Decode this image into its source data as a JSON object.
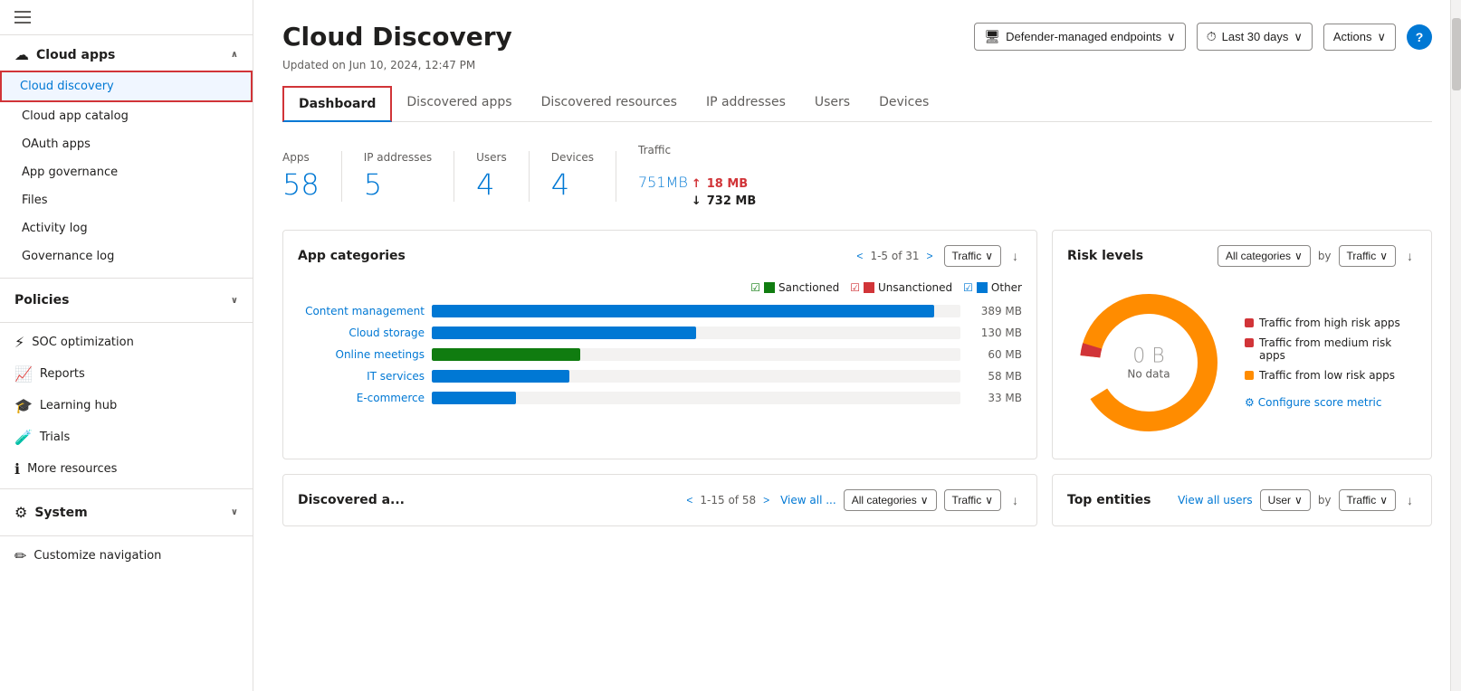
{
  "sidebar": {
    "hamburger_label": "Menu",
    "sections": [
      {
        "id": "cloud-apps",
        "label": "Cloud apps",
        "expanded": true,
        "items": [
          {
            "id": "cloud-discovery",
            "label": "Cloud discovery",
            "active": true
          },
          {
            "id": "cloud-app-catalog",
            "label": "Cloud app catalog"
          },
          {
            "id": "oauth-apps",
            "label": "OAuth apps"
          },
          {
            "id": "app-governance",
            "label": "App governance"
          },
          {
            "id": "files",
            "label": "Files"
          },
          {
            "id": "activity-log",
            "label": "Activity log"
          },
          {
            "id": "governance-log",
            "label": "Governance log"
          }
        ]
      },
      {
        "id": "policies",
        "label": "Policies",
        "expanded": false,
        "items": []
      }
    ],
    "main_items": [
      {
        "id": "soc-optimization",
        "label": "SOC optimization",
        "icon": "⚡"
      },
      {
        "id": "reports",
        "label": "Reports",
        "icon": "📈"
      },
      {
        "id": "learning-hub",
        "label": "Learning hub",
        "icon": "🎓"
      },
      {
        "id": "trials",
        "label": "Trials",
        "icon": "🧪"
      },
      {
        "id": "more-resources",
        "label": "More resources",
        "icon": "ℹ️"
      }
    ],
    "system_section": {
      "label": "System",
      "expanded": false
    },
    "customize_nav": "Customize navigation"
  },
  "page": {
    "title": "Cloud Discovery",
    "timestamp": "Updated on Jun 10, 2024, 12:47 PM",
    "header_controls": {
      "endpoint_btn": "Defender-managed endpoints",
      "time_btn": "Last 30 days",
      "actions_btn": "Actions"
    }
  },
  "tabs": [
    {
      "id": "dashboard",
      "label": "Dashboard",
      "active": true
    },
    {
      "id": "discovered-apps",
      "label": "Discovered apps"
    },
    {
      "id": "discovered-resources",
      "label": "Discovered resources"
    },
    {
      "id": "ip-addresses",
      "label": "IP addresses"
    },
    {
      "id": "users",
      "label": "Users"
    },
    {
      "id": "devices",
      "label": "Devices"
    }
  ],
  "stats": [
    {
      "id": "apps",
      "label": "Apps",
      "value": "58",
      "suffix": ""
    },
    {
      "id": "ip-addresses",
      "label": "IP addresses",
      "value": "5",
      "suffix": ""
    },
    {
      "id": "users",
      "label": "Users",
      "value": "4",
      "suffix": ""
    },
    {
      "id": "devices",
      "label": "Devices",
      "value": "4",
      "suffix": ""
    },
    {
      "id": "traffic",
      "label": "Traffic",
      "value": "751",
      "suffix": "MB",
      "upload": "18 MB",
      "download": "732 MB"
    }
  ],
  "app_categories": {
    "title": "App categories",
    "pagination": "1-5 of 31",
    "filter": "Traffic",
    "legend": [
      {
        "label": "Sanctioned",
        "color": "#107c10",
        "checkmark": "✓"
      },
      {
        "label": "Unsanctioned",
        "color": "#d13438",
        "checkmark": "✓"
      },
      {
        "label": "Other",
        "color": "#0078d4",
        "checkmark": "✓"
      }
    ],
    "bars": [
      {
        "label": "Content management",
        "value": "389 MB",
        "width_pct": 95,
        "color": "#0078d4"
      },
      {
        "label": "Cloud storage",
        "value": "130 MB",
        "width_pct": 50,
        "color": "#0078d4"
      },
      {
        "label": "Online meetings",
        "value": "60 MB",
        "width_pct": 28,
        "color": "#107c10"
      },
      {
        "label": "IT services",
        "value": "58 MB",
        "width_pct": 26,
        "color": "#0078d4"
      },
      {
        "label": "E-commerce",
        "value": "33 MB",
        "width_pct": 16,
        "color": "#0078d4"
      }
    ]
  },
  "risk_levels": {
    "title": "Risk levels",
    "filter_category": "All categories",
    "filter_by": "Traffic",
    "donut": {
      "center_value": "0 B",
      "center_label": "No data",
      "segments": [
        {
          "color": "#d13438",
          "pct": 3
        },
        {
          "color": "#ff8c00",
          "pct": 97
        }
      ]
    },
    "legend": [
      {
        "label": "Traffic from high risk apps",
        "color": "#d13438"
      },
      {
        "label": "Traffic from medium risk apps",
        "color": "#d13438"
      },
      {
        "label": "Traffic from low risk apps",
        "color": "#ff8c00"
      }
    ],
    "configure_link": "Configure score metric"
  },
  "discovered_apps": {
    "title": "Discovered a...",
    "pagination": "1-15 of 58",
    "view_all": "View all ...",
    "filter_category": "All categories",
    "filter_by": "Traffic"
  },
  "top_entities": {
    "title": "Top entities",
    "view_all": "View all users",
    "filter_user": "User",
    "filter_by": "Traffic"
  },
  "colors": {
    "accent": "#0078d4",
    "danger": "#d13438",
    "success": "#107c10",
    "orange": "#ff8c00",
    "text_primary": "#201f1e",
    "text_secondary": "#605e5c"
  }
}
